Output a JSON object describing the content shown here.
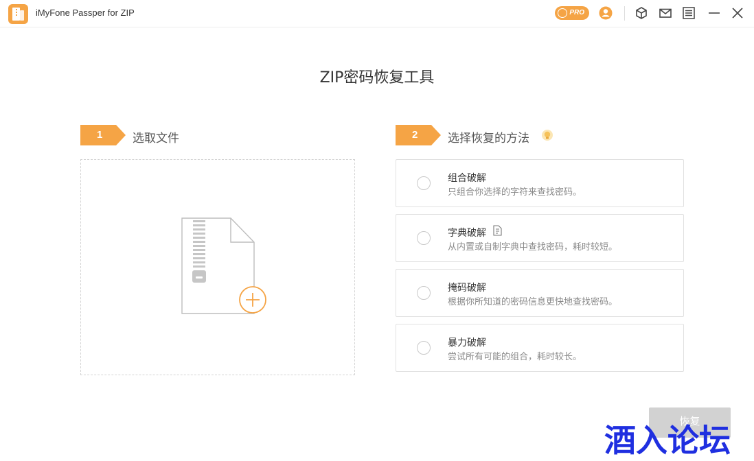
{
  "app": {
    "title": "iMyFone Passper for ZIP",
    "pro_label": "PRO",
    "accent_color": "#f5a445"
  },
  "titlebar_icons": [
    "pro-badge",
    "user-icon",
    "cube-icon",
    "mail-icon",
    "menu-icon",
    "minimize-icon",
    "close-icon"
  ],
  "page_title": "ZIP密码恢复工具",
  "step1": {
    "number": "1",
    "label": "选取文件"
  },
  "step2": {
    "number": "2",
    "label": "选择恢复的方法",
    "hint_icon": "lightbulb-icon"
  },
  "methods": [
    {
      "title": "组合破解",
      "desc": "只组合你选择的字符来查找密码。",
      "selected": false
    },
    {
      "title": "字典破解",
      "desc": "从内置或自制字典中查找密码，耗时较短。",
      "selected": false,
      "icon": "document-icon"
    },
    {
      "title": "掩码破解",
      "desc": "根据你所知道的密码信息更快地查找密码。",
      "selected": false
    },
    {
      "title": "暴力破解",
      "desc": "尝试所有可能的组合，耗时较长。",
      "selected": false
    }
  ],
  "dropzone": {
    "icon": "zip-file-add-icon"
  },
  "recover_button": {
    "label": "恢复",
    "enabled": false,
    "color": "#d2d2d2"
  },
  "watermark": {
    "text": "酒入论坛",
    "color": "#1f2fe0"
  }
}
